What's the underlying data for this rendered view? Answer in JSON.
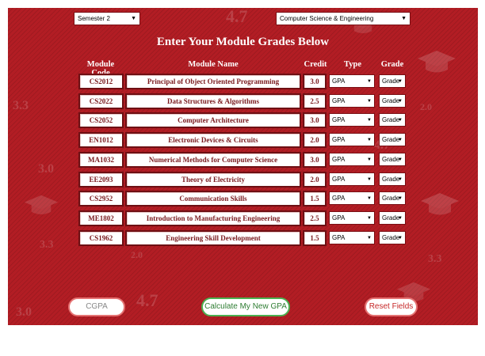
{
  "semester_select": {
    "value": "Semester 2"
  },
  "department_select": {
    "value": "Computer Science & Engineering"
  },
  "title": "Enter Your Module Grades Below",
  "headers": {
    "code": "Module Code",
    "name": "Module Name",
    "credit": "Credit",
    "type": "Type",
    "grade": "Grade"
  },
  "modules": [
    {
      "code": "CS2012",
      "name": "Principal of Object Oriented Programming",
      "credit": "3.0",
      "type": "GPA",
      "grade": "Grade"
    },
    {
      "code": "CS2022",
      "name": "Data Structures & Algorithms",
      "credit": "2.5",
      "type": "GPA",
      "grade": "Grade"
    },
    {
      "code": "CS2052",
      "name": "Computer Architecture",
      "credit": "3.0",
      "type": "GPA",
      "grade": "Grade"
    },
    {
      "code": "EN1012",
      "name": "Electronic Devices & Circuits",
      "credit": "2.0",
      "type": "GPA",
      "grade": "Grade"
    },
    {
      "code": "MA1032",
      "name": "Numerical Methods for Computer Science",
      "credit": "3.0",
      "type": "GPA",
      "grade": "Grade"
    },
    {
      "code": "EE2093",
      "name": "Theory of Electricity",
      "credit": "2.0",
      "type": "GPA",
      "grade": "Grade"
    },
    {
      "code": "CS2952",
      "name": "Communication Skills",
      "credit": "1.5",
      "type": "GPA",
      "grade": "Grade"
    },
    {
      "code": "ME1802",
      "name": "Introduction to Manufacturing Engineering",
      "credit": "2.5",
      "type": "GPA",
      "grade": "Grade"
    },
    {
      "code": "CS1962",
      "name": "Engineering Skill Development",
      "credit": "1.5",
      "type": "GPA",
      "grade": "Grade"
    }
  ],
  "buttons": {
    "cgpa": "CGPA",
    "calculate": "Calculate My New GPA",
    "reset": "Reset Fields"
  },
  "decorations": {
    "n1": "3.0",
    "n2": "3.3",
    "n3": "4.7",
    "n4": "2.0",
    "n5": "3.0",
    "n6": "3.3",
    "n7": "4.7",
    "n8": "3.0",
    "n9": "2.0",
    "n10": "4.7",
    "n11": "3.3"
  },
  "colors": {
    "background": "#b21d24",
    "cell_text": "#7a1a1e",
    "calculate_border": "#4caf50",
    "button_border": "#e57373"
  }
}
